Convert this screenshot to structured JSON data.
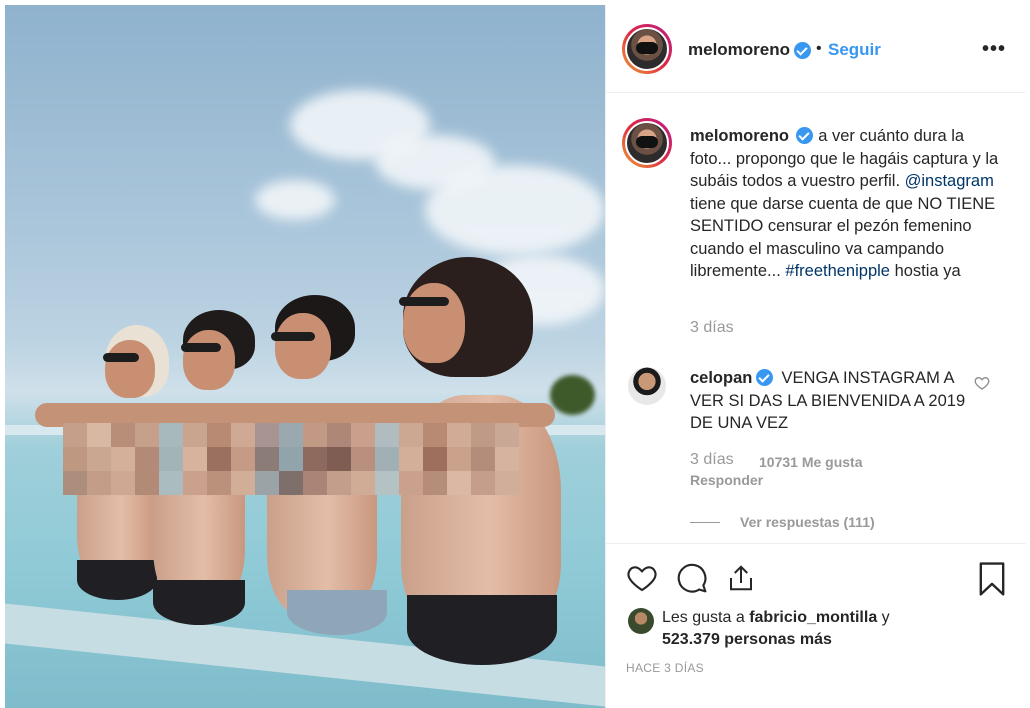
{
  "post": {
    "username": "melomoreno",
    "follow_label": "Seguir",
    "separator": "•",
    "more_label": "•••"
  },
  "caption": {
    "username": "melomoreno",
    "text_1": "a ver cuánto dura la foto... propongo que le hagáis captura y la subáis todos a vuestro perfil.",
    "mention": "@instagram",
    "text_2": "tiene que darse cuenta de que NO TIENE SENTIDO censurar el pezón femenino cuando el masculino va campando libremente...",
    "hashtag": "#freethenipple",
    "text_3": "hostia ya",
    "time": "3 días"
  },
  "comment": {
    "username": "celopan",
    "text": "VENGA INSTAGRAM A VER SI DAS LA BIENVENIDA A 2019 DE UNA VEZ",
    "time": "3 días",
    "likes": "10731 Me gusta",
    "reply_label": "Responder",
    "view_replies": "Ver respuestas (111)"
  },
  "likes": {
    "prefix": "Les gusta a",
    "user": "fabricio_montilla",
    "conj": "y",
    "count": "523.379 personas más"
  },
  "footer": {
    "time_ago": "HACE 3 DÍAS"
  }
}
